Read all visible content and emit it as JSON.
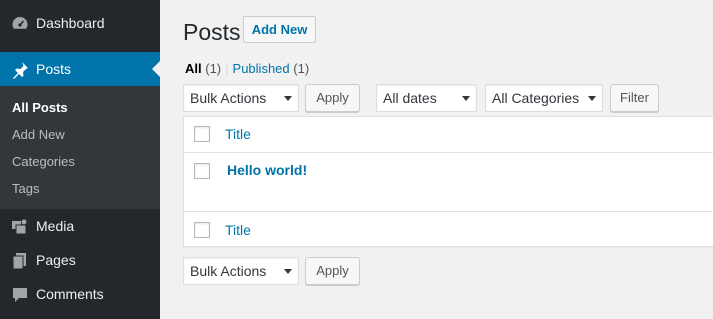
{
  "sidebar": {
    "items": [
      {
        "label": "Dashboard",
        "icon": "dashboard-icon"
      },
      {
        "label": "Posts",
        "icon": "pin-icon"
      },
      {
        "label": "Media",
        "icon": "media-icon"
      },
      {
        "label": "Pages",
        "icon": "pages-icon"
      },
      {
        "label": "Comments",
        "icon": "comments-icon"
      }
    ],
    "submenu": [
      {
        "label": "All Posts"
      },
      {
        "label": "Add New"
      },
      {
        "label": "Categories"
      },
      {
        "label": "Tags"
      }
    ]
  },
  "main": {
    "title": "Posts",
    "add_new_label": "Add New",
    "filters": {
      "all_label": "All",
      "all_count": "(1)",
      "separator": "|",
      "published_label": "Published",
      "published_count": "(1)"
    },
    "top_nav": {
      "bulk_actions": "Bulk Actions",
      "apply": "Apply",
      "dates": "All dates",
      "categories": "All Categories",
      "filter": "Filter"
    },
    "table": {
      "header_title": "Title",
      "footer_title": "Title",
      "rows": [
        {
          "title": "Hello world!"
        }
      ]
    },
    "bottom_nav": {
      "bulk_actions": "Bulk Actions",
      "apply": "Apply"
    }
  },
  "colors": {
    "sidebar_bg": "#23282d",
    "submenu_bg": "#32373c",
    "accent": "#0073aa",
    "page_bg": "#f1f1f1"
  }
}
